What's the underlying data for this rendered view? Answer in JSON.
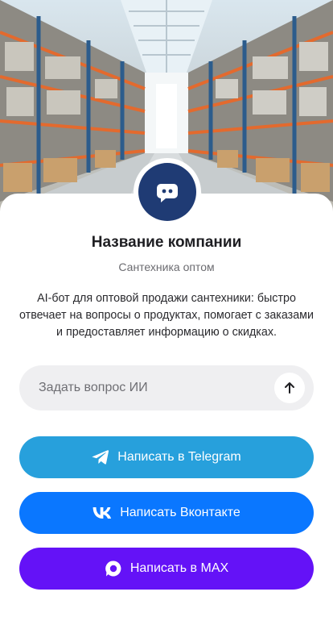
{
  "hero": {
    "image": "warehouse-shelves-photo"
  },
  "company": {
    "name": "Название компании",
    "subtitle": "Сантехника оптом",
    "description": "AI-бот для оптовой продажи сантехники: быстро отвечает на вопросы о продуктах, помогает с заказами и предоставляет информацию о скидках.",
    "avatar_icon": "chat-bot-icon"
  },
  "ask": {
    "placeholder": "Задать вопрос ИИ",
    "value": "",
    "send_icon": "arrow-up-icon"
  },
  "buttons": [
    {
      "label": "Написать в Telegram",
      "icon": "telegram-icon",
      "color": "#27a0dc"
    },
    {
      "label": "Написать Вконтакте",
      "icon": "vk-icon",
      "color": "#0a77ff"
    },
    {
      "label": "Написать в MAX",
      "icon": "max-icon",
      "color": "#6412f7"
    }
  ]
}
